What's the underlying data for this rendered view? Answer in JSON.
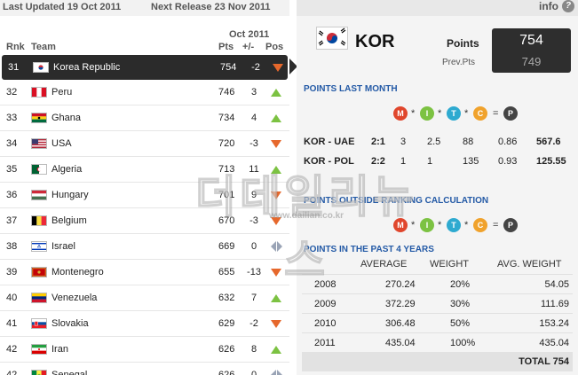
{
  "header": {
    "last_updated": "Last Updated 19 Oct 2011",
    "next_release": "Next Release 23 Nov 2011",
    "month": "Oct 2011",
    "col_rnk": "Rnk",
    "col_team": "Team",
    "col_pts": "Pts",
    "col_change": "+/-",
    "col_pos": "Pos"
  },
  "rows": [
    {
      "rank": "31",
      "team": "Korea Republic",
      "pts": "754",
      "change": "-2",
      "trend": "down",
      "flag": "kor",
      "selected": true
    },
    {
      "rank": "32",
      "team": "Peru",
      "pts": "746",
      "change": "3",
      "trend": "up",
      "flag": "per"
    },
    {
      "rank": "33",
      "team": "Ghana",
      "pts": "734",
      "change": "4",
      "trend": "up",
      "flag": "gha"
    },
    {
      "rank": "34",
      "team": "USA",
      "pts": "720",
      "change": "-3",
      "trend": "down",
      "flag": "usa"
    },
    {
      "rank": "35",
      "team": "Algeria",
      "pts": "713",
      "change": "11",
      "trend": "up",
      "flag": "alg"
    },
    {
      "rank": "36",
      "team": "Hungary",
      "pts": "701",
      "change": "9",
      "trend": "down",
      "flag": "hun"
    },
    {
      "rank": "37",
      "team": "Belgium",
      "pts": "670",
      "change": "-3",
      "trend": "down",
      "flag": "bel"
    },
    {
      "rank": "38",
      "team": "Israel",
      "pts": "669",
      "change": "0",
      "trend": "same",
      "flag": "isr"
    },
    {
      "rank": "39",
      "team": "Montenegro",
      "pts": "655",
      "change": "-13",
      "trend": "down",
      "flag": "mne"
    },
    {
      "rank": "40",
      "team": "Venezuela",
      "pts": "632",
      "change": "7",
      "trend": "up",
      "flag": "ven"
    },
    {
      "rank": "41",
      "team": "Slovakia",
      "pts": "629",
      "change": "-2",
      "trend": "down",
      "flag": "svk"
    },
    {
      "rank": "42",
      "team": "Iran",
      "pts": "626",
      "change": "8",
      "trend": "up",
      "flag": "irn"
    },
    {
      "rank": "42",
      "team": "Senegal",
      "pts": "626",
      "change": "0",
      "trend": "same",
      "flag": "sen"
    }
  ],
  "detail": {
    "info_label": "info",
    "info_icon": "?",
    "team_code": "KOR",
    "points_label": "Points",
    "points_value": "754",
    "prev_label": "Prev.Pts",
    "prev_value": "749",
    "section_last_month": "POINTS LAST MONTH",
    "section_outside": "POINTS OUTSIDE RANKING CALCULATION",
    "section_past": "POINTS IN THE PAST 4 YEARS",
    "formula": {
      "m": "M",
      "i": "I",
      "t": "T",
      "c": "C",
      "p": "P",
      "times": "*",
      "equals": "="
    },
    "matches": [
      {
        "match": "KOR - UAE",
        "score": "2:1",
        "m": "3",
        "i": "2.5",
        "t": "88",
        "c": "0.86",
        "p": "567.6"
      },
      {
        "match": "KOR - POL",
        "score": "2:2",
        "m": "1",
        "i": "1",
        "t": "135",
        "c": "0.93",
        "p": "125.55"
      }
    ],
    "years_header": {
      "average": "AVERAGE",
      "weight": "WEIGHT",
      "avg_weight": "AVG. WEIGHT"
    },
    "years": [
      {
        "year": "2008",
        "average": "270.24",
        "weight": "20%",
        "avg_weight": "54.05"
      },
      {
        "year": "2009",
        "average": "372.29",
        "weight": "30%",
        "avg_weight": "111.69"
      },
      {
        "year": "2010",
        "average": "306.48",
        "weight": "50%",
        "avg_weight": "153.24"
      },
      {
        "year": "2011",
        "average": "435.04",
        "weight": "100%",
        "avg_weight": "435.04"
      }
    ],
    "total": "TOTAL 754"
  },
  "watermark": {
    "text": "더데일리뉴스",
    "url": "www.dailian.co.kr"
  },
  "colors": {
    "M": "#e0462c",
    "I": "#7cc242",
    "T": "#2eaad0",
    "C": "#f0a22c",
    "P": "#444444",
    "up": "#7cc242",
    "down": "#e6682c",
    "section": "#245aa6"
  }
}
